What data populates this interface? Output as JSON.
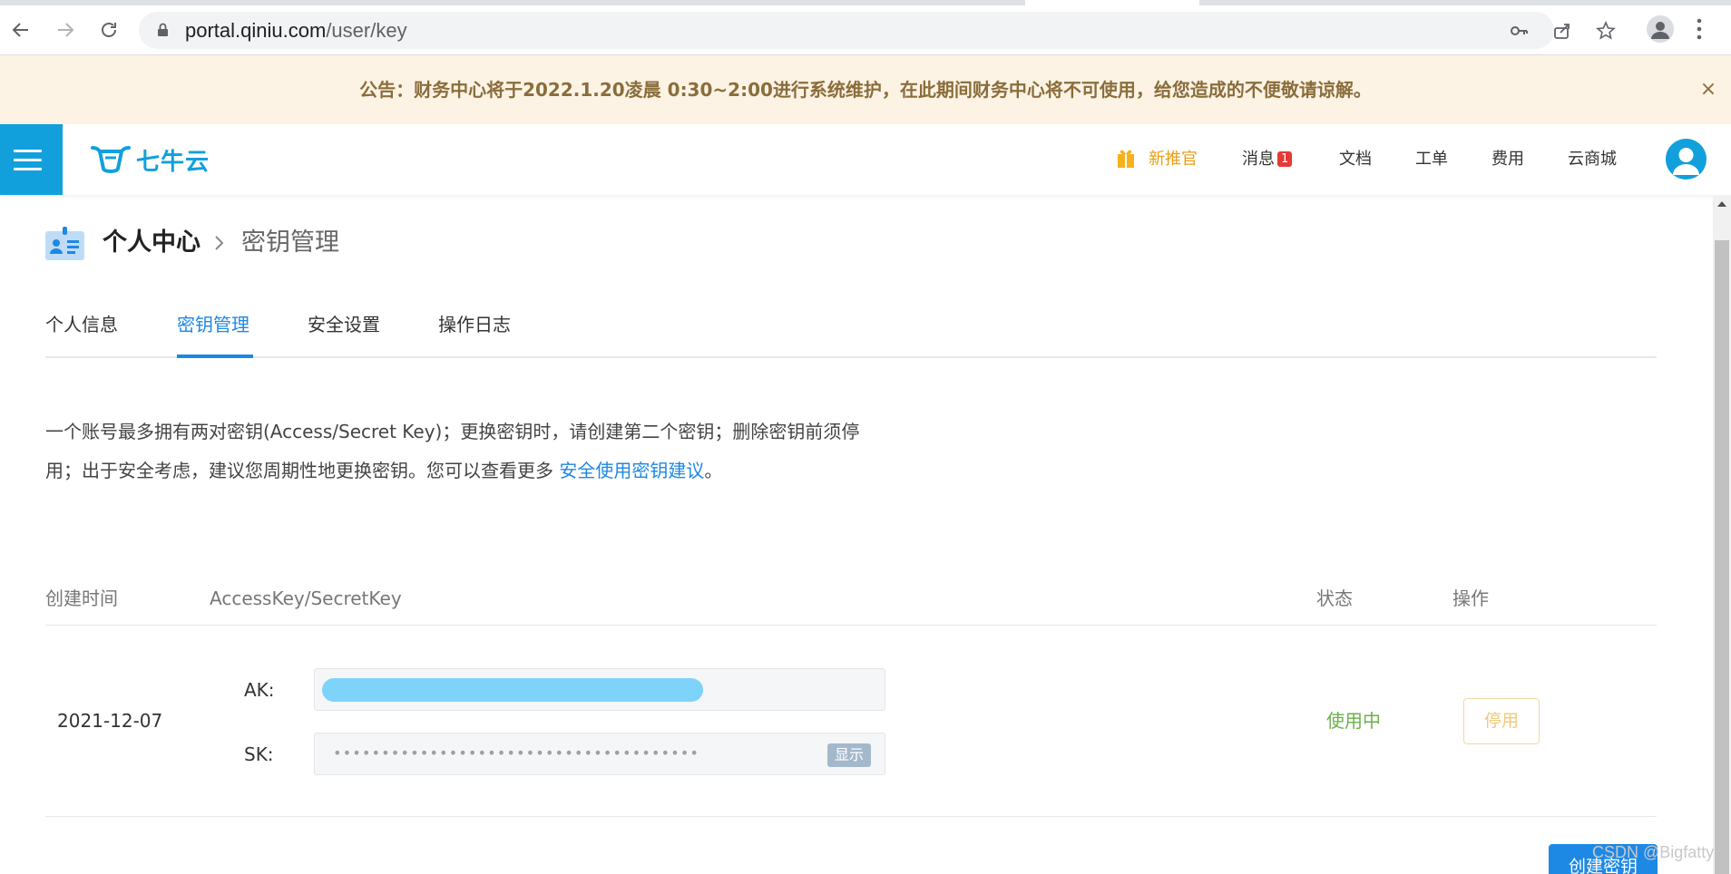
{
  "browser": {
    "url_host": "portal.qiniu.com",
    "url_path": "/user/key"
  },
  "announcement": {
    "text": "公告：财务中心将于2022.1.20凌晨 0:30~2:00进行系统维护，在此期间财务中心将不可使用，给您造成的不便敬请谅解。",
    "close_icon": "×"
  },
  "header": {
    "logo_text": "七牛云",
    "nav": {
      "promo": "新推官",
      "messages": "消息",
      "messages_badge": "1",
      "docs": "文档",
      "tickets": "工单",
      "billing": "费用",
      "market": "云商城"
    },
    "accent_color": "#11a0dc"
  },
  "breadcrumb": {
    "root": "个人中心",
    "current": "密钥管理"
  },
  "tabs": [
    {
      "label": "个人信息"
    },
    {
      "label": "密钥管理"
    },
    {
      "label": "安全设置"
    },
    {
      "label": "操作日志"
    }
  ],
  "description": {
    "line1": "一个账号最多拥有两对密钥(Access/Secret Key)；更换密钥时，请创建第二个密钥；删除密钥前须停",
    "line2": "用；出于安全考虑，建议您周期性地更换密钥。您可以查看更多 ",
    "link": "安全使用密钥建议",
    "end": "。"
  },
  "table": {
    "headers": {
      "created": "创建时间",
      "keys": "AccessKey/SecretKey",
      "status": "状态",
      "actions": "操作"
    },
    "rows": [
      {
        "date": "2021-12-07",
        "ak_label": "AK:",
        "sk_label": "SK:",
        "sk_masked": "••••••••••••••••••••••••••••••••••••••",
        "show_label": "显示",
        "status": "使用中",
        "disable_label": "停用"
      }
    ]
  },
  "create_button": "创建密钥",
  "watermark": "CSDN @Bigfatty",
  "colors": {
    "link": "#1e88e5",
    "status_active": "#6ab04c",
    "announce_bg": "#fcf3e4"
  }
}
